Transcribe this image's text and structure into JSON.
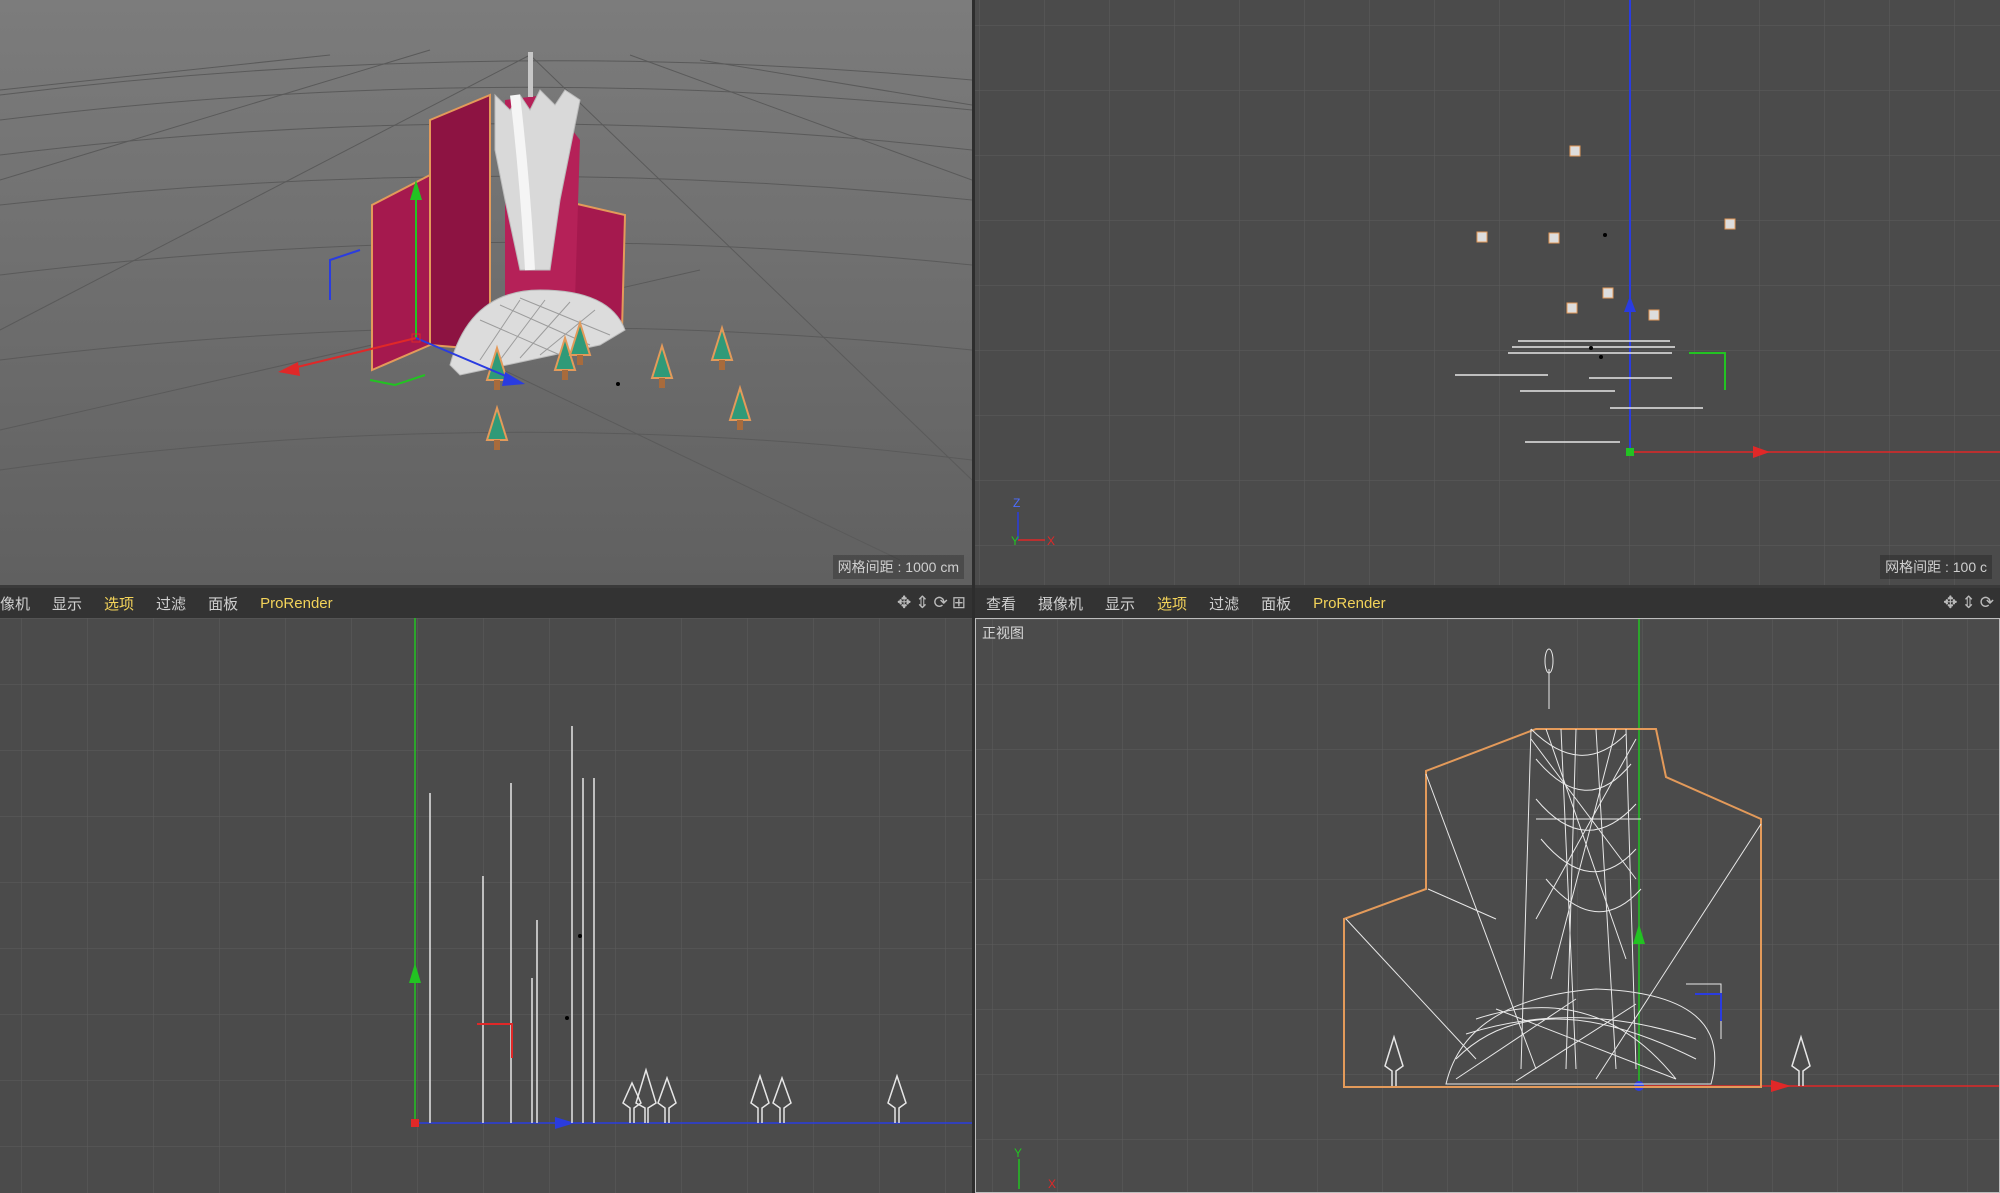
{
  "viewports": {
    "perspective": {
      "grid_label": "网格间距 : 1000 cm"
    },
    "top": {
      "grid_label": "网格间距 : 100 c",
      "axis_z": "Z",
      "axis_y": "Y",
      "axis_x": "X"
    },
    "side": {},
    "front": {
      "view_label": "正视图",
      "axis_y": "Y",
      "axis_x": "X"
    }
  },
  "menubar_left": {
    "items": [
      "像机",
      "显示",
      "选项",
      "过滤",
      "面板",
      "ProRender"
    ],
    "active_index": 2
  },
  "menubar_right": {
    "items": [
      "查看",
      "摄像机",
      "显示",
      "选项",
      "过滤",
      "面板",
      "ProRender"
    ],
    "active_index": 3
  },
  "icons": [
    "move-icon",
    "dolly-icon",
    "rotate-icon",
    "layout-icon"
  ],
  "colors": {
    "accent": "#f3d35a",
    "building": "#a5194e",
    "tree": "#2f9a78",
    "selection": "#e39a5a",
    "axis_x": "#e02828",
    "axis_y": "#22c322",
    "axis_z": "#2a3ce0"
  }
}
